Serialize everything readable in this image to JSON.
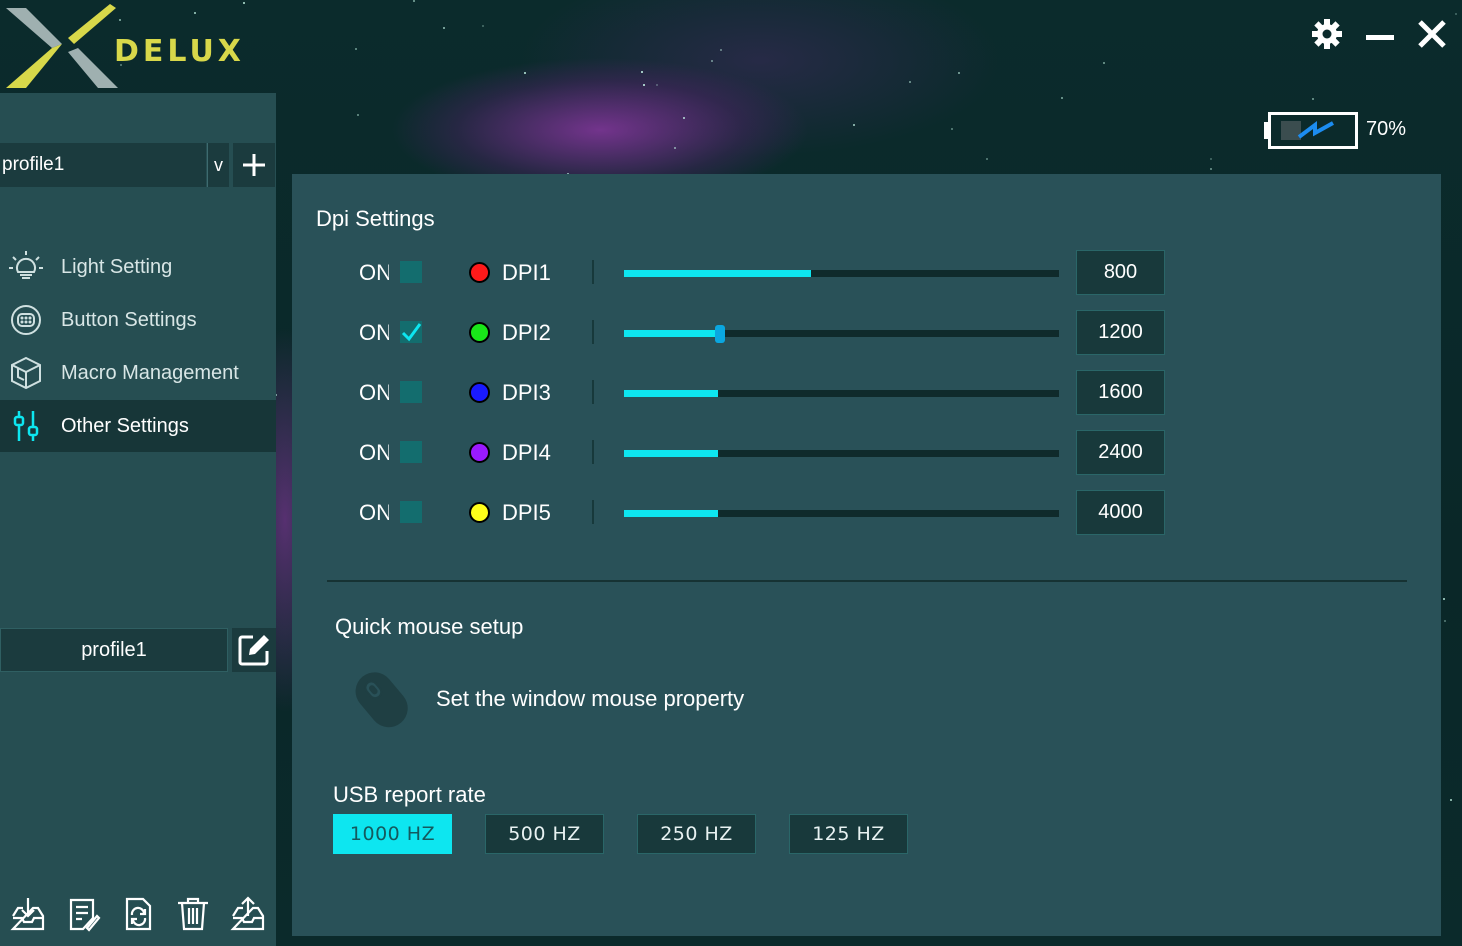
{
  "brand": {
    "name": "DELUX"
  },
  "window_controls": {
    "settings_icon": "gear-icon",
    "minimize_icon": "minimize-icon",
    "close_icon": "close-icon"
  },
  "battery": {
    "percent_label": "70%",
    "level": 0.7,
    "charging": true
  },
  "sidebar": {
    "profile_selector": {
      "value": "profile1",
      "arrow": "v"
    },
    "nav": [
      {
        "label": "Light Setting",
        "icon": "light-bulb-icon",
        "active": false
      },
      {
        "label": "Button Settings",
        "icon": "mouse-buttons-icon",
        "active": false
      },
      {
        "label": "Macro Management",
        "icon": "cube-icon",
        "active": false
      },
      {
        "label": "Other Settings",
        "icon": "sliders-icon",
        "active": true
      }
    ],
    "current_profile": "profile1",
    "tools": [
      "import-icon",
      "notes-icon",
      "reset-icon",
      "delete-icon",
      "export-icon"
    ]
  },
  "dpi": {
    "title": "Dpi Settings",
    "on_label": "ON",
    "max_value": 16000,
    "rows": [
      {
        "name": "DPI1",
        "value": "800",
        "color": "#ff1a1a",
        "checked": false,
        "fill_fraction": 0.43,
        "selected": false
      },
      {
        "name": "DPI2",
        "value": "1200",
        "color": "#19e619",
        "checked": true,
        "fill_fraction": 0.22,
        "selected": true
      },
      {
        "name": "DPI3",
        "value": "1600",
        "color": "#1a1aff",
        "checked": false,
        "fill_fraction": 0.215,
        "selected": false
      },
      {
        "name": "DPI4",
        "value": "2400",
        "color": "#9a1aff",
        "checked": false,
        "fill_fraction": 0.215,
        "selected": false
      },
      {
        "name": "DPI5",
        "value": "4000",
        "color": "#ffff1a",
        "checked": false,
        "fill_fraction": 0.215,
        "selected": false
      }
    ]
  },
  "quick_setup": {
    "title": "Quick mouse setup",
    "text": "Set the window mouse property"
  },
  "usb": {
    "title": "USB report rate",
    "options": [
      {
        "label": "1000 HZ",
        "active": true
      },
      {
        "label": "500 HZ",
        "active": false
      },
      {
        "label": "250 HZ",
        "active": false
      },
      {
        "label": "125 HZ",
        "active": false
      }
    ]
  },
  "colors": {
    "accent": "#0de6f0",
    "panel": "#295158",
    "sidebar": "#264e52"
  }
}
